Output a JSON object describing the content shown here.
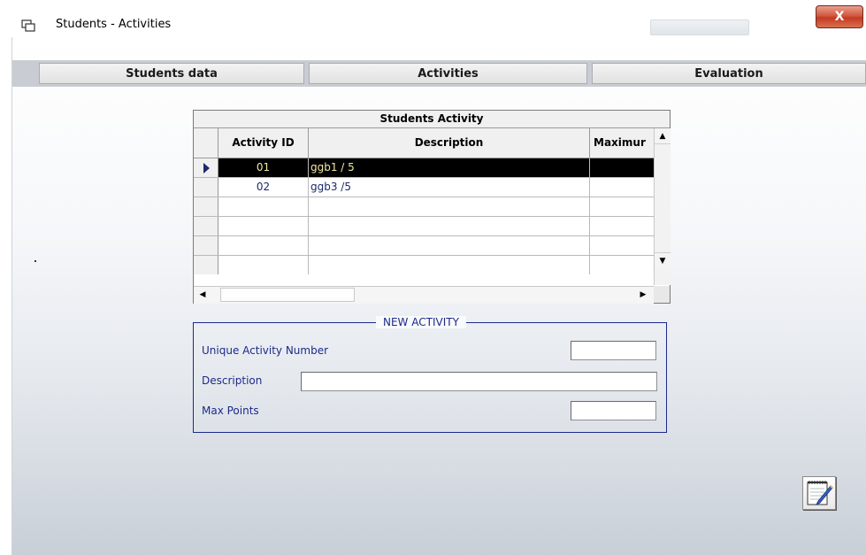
{
  "window": {
    "title": "Students  -  Activities",
    "close_label": "X"
  },
  "tabs": [
    {
      "label": "Students data"
    },
    {
      "label": "Activities"
    },
    {
      "label": "Evaluation"
    }
  ],
  "grid": {
    "caption": "Students Activity",
    "columns": [
      "Activity ID",
      "Description",
      "Maximur"
    ],
    "rows": [
      {
        "id": "01",
        "description": "ggb1 / 5",
        "max": "",
        "selected": true
      },
      {
        "id": "02",
        "description": "ggb3 /5",
        "max": "",
        "selected": false
      }
    ],
    "empty_rows": 4
  },
  "new_activity": {
    "legend": "NEW ACTIVITY",
    "unique_label": "Unique Activity Number",
    "unique_value": "",
    "description_label": "Description",
    "description_value": "",
    "max_points_label": "Max Points",
    "max_points_value": ""
  },
  "icons": {
    "app": "window-app-icon",
    "save": "notepad-pen-icon"
  }
}
